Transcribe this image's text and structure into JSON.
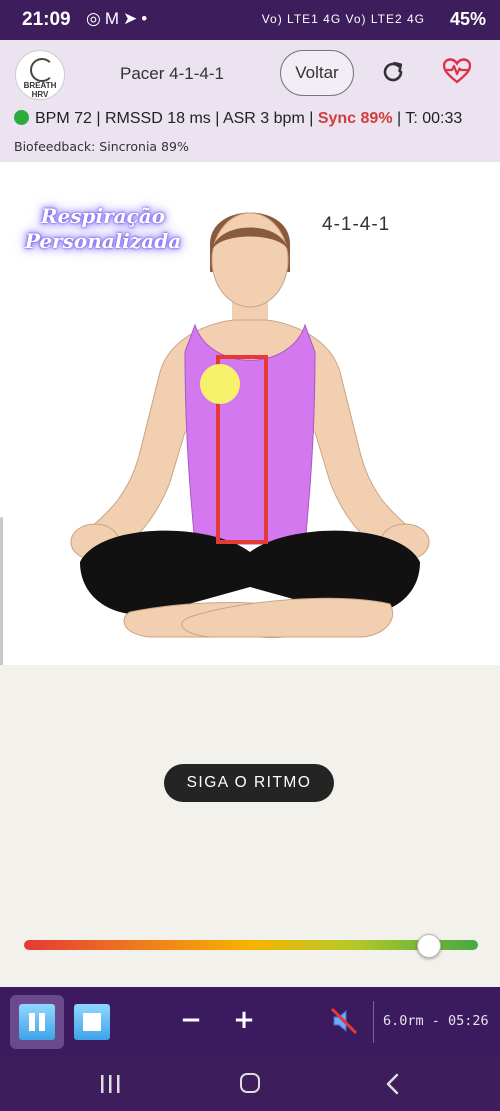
{
  "status_bar": {
    "time": "21:09",
    "left_icons": [
      "instagram-icon",
      "gmail-icon",
      "telegram-icon",
      "dot-icon"
    ],
    "network": "Vo) LTE1 4G  Vo) LTE2 4G",
    "battery": "45%"
  },
  "header": {
    "logo_text": "BREATH HRV",
    "title": "Pacer 4-1-4-1",
    "back_label": "Voltar",
    "metrics": {
      "bpm": "BPM 72",
      "rmssd": "RMSSD 18 ms",
      "asr": "ASR 3 bpm",
      "sync": "Sync 89%",
      "time": "T: 00:33",
      "separator": "|"
    },
    "biofeedback": "Biofeedback: Sincronia 89%"
  },
  "illustration": {
    "brand_line1": "Respiração",
    "brand_line2": "Personalizada",
    "pattern": "4-1-4-1"
  },
  "main": {
    "rhythm_label": "SIGA O RITMO",
    "slider_value_pct": 89
  },
  "controls": {
    "minus_label": "−",
    "plus_label": "+",
    "rate_timer": "6.0rm - 05:26"
  },
  "colors": {
    "accent_purple": "#3d1d5c",
    "header_bg": "#ebe3f0",
    "sync_red": "#d53b3b",
    "status_green": "#2eaa3c",
    "tank_top": "#d478f0",
    "breath_ball": "#f7f26a"
  }
}
